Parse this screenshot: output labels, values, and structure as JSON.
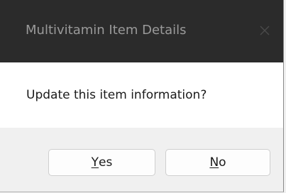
{
  "window": {
    "title": "Multivitamin Item Details",
    "close_icon": "close-icon",
    "titlebar_color": "#2b2b2b",
    "title_color": "#9a9a9a"
  },
  "message": {
    "text": "Update this item information?"
  },
  "buttons": {
    "yes": {
      "mnemonic": "Y",
      "rest": "es"
    },
    "no": {
      "mnemonic": "N",
      "rest": "o"
    }
  }
}
